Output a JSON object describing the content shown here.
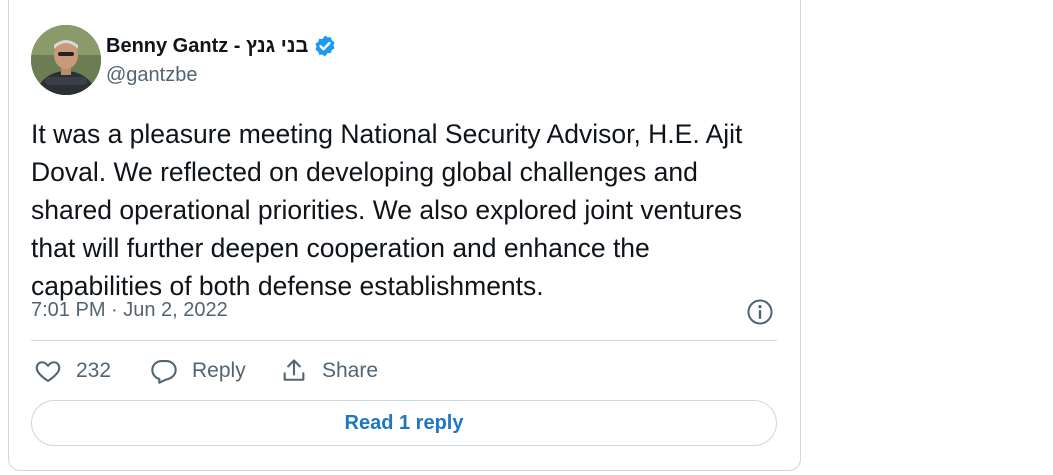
{
  "author": {
    "display_name": "Benny Gantz - בני גנץ",
    "handle": "@gantzbe",
    "verified": true
  },
  "tweet": {
    "text": "It was a pleasure meeting National Security Advisor, H.E. Ajit Doval. We reflected on developing global challenges and shared operational priorities. We also explored joint ventures that will further deepen cooperation and enhance the capabilities of both defense establishments.",
    "timestamp": "7:01 PM · Jun 2, 2022"
  },
  "actions": {
    "like_count": "232",
    "reply_label": "Reply",
    "share_label": "Share"
  },
  "read_replies_label": "Read 1 reply",
  "colors": {
    "text_primary": "#0f1419",
    "text_secondary": "#536471",
    "border": "#cfd9de",
    "verified_blue": "#1d9bf0",
    "link_blue": "#1d77c2"
  },
  "icons": {
    "verified": "verified-badge-icon",
    "info": "info-icon",
    "like": "heart-icon",
    "reply": "speech-bubble-icon",
    "share": "share-upload-icon"
  }
}
